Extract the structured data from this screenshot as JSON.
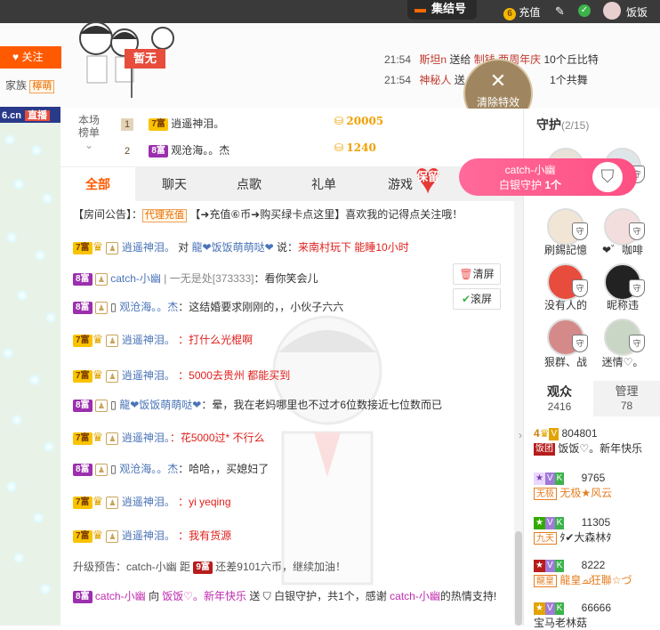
{
  "topbar": {
    "assembly": "集结号",
    "recharge": "充值",
    "username": "饭饭♡。"
  },
  "header": {
    "follow": "关注",
    "family_label": "家族",
    "family_name": "檸萌",
    "status_flag": "暂无",
    "history": [
      {
        "time": "21:54",
        "user": "斯坦n",
        "verb": "送给",
        "target": "制钱",
        "item": "两周年庆",
        "rest": "10个丘比特"
      },
      {
        "time": "21:54",
        "user": "神秘人",
        "verb": "送",
        "rest": "1个共舞"
      }
    ],
    "clear_fx": "清除特效"
  },
  "brand": {
    "site": "6.cn",
    "live": "直播"
  },
  "ranking": {
    "label_top": "本场",
    "label_bottom": "榜单",
    "rows": [
      {
        "no": "1",
        "wealth": "7富",
        "name": "逍遥神泪。",
        "score": "20005"
      },
      {
        "no": "2",
        "wealth": "8富",
        "name": "观沧海。。杰",
        "score": "1240"
      }
    ]
  },
  "tabs": [
    "全部",
    "聊天",
    "点歌",
    "礼单",
    "游戏"
  ],
  "guard_popup": {
    "keep": "保留",
    "name": "catch-小幽",
    "desc": "白银守护",
    "count": "1个"
  },
  "chat": {
    "notice_label": "【房间公告】：",
    "notice_tag": "代理充值",
    "notice_text": "【➜充值⑥币➜购买绿卡点这里】喜欢我的记得点关注哦！",
    "clear_btn": "清屏",
    "scroll_btn": "滚屏",
    "messages": [
      {
        "wealth": "7富",
        "name": "逍遥神泪。",
        "mid": "对",
        "target": "龍❤饭饭萌萌哒❤",
        "say": "说：",
        "text": "来南村玩下 能睡10小时"
      },
      {
        "wealth": "8富",
        "name": "catch-小幽",
        "sep": "|",
        "target": "一无是处",
        "target_id": "[373333]",
        "text": "：看你笑会儿"
      },
      {
        "wealth": "8富",
        "name": "观沧海。。杰",
        "text": "：这结婚要求刚刚的，，小伙子六六"
      },
      {
        "wealth": "7富",
        "name": "逍遥神泪。",
        "text": "：打什么光棍啊"
      },
      {
        "wealth": "7富",
        "name": "逍遥神泪。",
        "text": "：5000去贵州 都能买到"
      },
      {
        "wealth": "8富",
        "name": "龍❤饭饭萌萌哒❤",
        "text": "：晕，我在老妈哪里也不过才6位数接近七位数而已"
      },
      {
        "wealth": "7富",
        "name": "逍遥神泪。",
        "text": "：花5000过* 不行么"
      },
      {
        "wealth": "8富",
        "name": "观沧海。。杰",
        "text": "：哈哈，，买媳妇了"
      },
      {
        "wealth": "7富",
        "name": "逍遥神泪。",
        "text": "：yi yeqing"
      },
      {
        "wealth": "7富",
        "name": "逍遥神泪。",
        "text": "：我有货源"
      }
    ],
    "upgrade": {
      "prefix": "升级预告：catch-小幽 距",
      "level": "9富",
      "suffix": "还差9101六币，继续加油！"
    },
    "gift": {
      "wealth": "8富",
      "from": "catch-小幽",
      "to_word": "向",
      "to": "饭饭♡。新年快乐",
      "send": "送",
      "item": "白银守护，共1个，感谢",
      "thanks_name": "catch-小幽",
      "tail": "的热情支持!"
    }
  },
  "guards": {
    "title": "守护",
    "count": "(2/15)",
    "items": [
      {
        "name": ""
      },
      {
        "name": ""
      },
      {
        "name": "刷錫記憶"
      },
      {
        "name": "❤゛咖啡"
      },
      {
        "name": "没有人的"
      },
      {
        "name": "昵称违"
      },
      {
        "name": "狠群、战"
      },
      {
        "name": "迷情♡。"
      }
    ]
  },
  "audience": {
    "tab_audience": "观众",
    "audience_count": "2416",
    "tab_admin": "管理",
    "admin_count": "78",
    "rows": [
      {
        "level": "4",
        "badge": "饭团",
        "id": "804801",
        "name": "饭饭♡。新年快乐"
      },
      {
        "badge": "无极",
        "id": "9765",
        "name": "无极★风云"
      },
      {
        "badge": "九天",
        "id": "11305",
        "name": "ﾀ✔大森林ﾀ"
      },
      {
        "badge": "龍皇",
        "id": "8222",
        "name": "龍皇ച狂聯☆づ"
      },
      {
        "badge": "",
        "id": "66666",
        "name": "宝马老林菇"
      }
    ]
  }
}
